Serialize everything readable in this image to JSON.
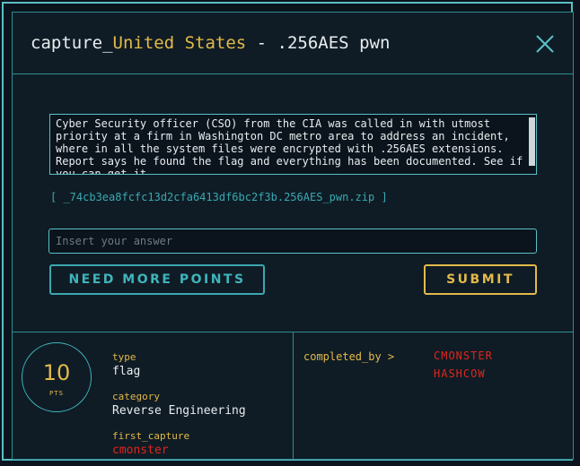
{
  "dialog": {
    "title_prefix": "capture_",
    "title_country": "United States",
    "title_suffix": " - .256AES pwn",
    "close_icon": "close-icon"
  },
  "challenge": {
    "description": "Cyber Security officer (CSO) from the CIA was called in with utmost priority at a firm in Washington DC metro area to address an incident, where in all the system files were encrypted with .256AES extensions. Report says he found the flag and everything has been documented. See if you can get it.",
    "file_link": "[ _74cb3ea8fcfc13d2cfa6413df6bc2f3b.256AES_pwn.zip ]"
  },
  "answer": {
    "placeholder": "Insert your answer",
    "value": ""
  },
  "buttons": {
    "need_points": "NEED MORE POINTS",
    "submit": "SUBMIT"
  },
  "stats": {
    "points_value": "10",
    "points_unit": "PTS",
    "type_label": "type",
    "type_value": "flag",
    "category_label": "category",
    "category_value": "Reverse Engineering",
    "first_capture_label": "first_capture",
    "first_capture_value": "cmonster",
    "completed_by_label": "completed_by >",
    "completed_by": [
      "CMONSTER",
      "HASHCOW"
    ]
  },
  "colors": {
    "accent_teal": "#5bc0c7",
    "accent_yellow": "#e3b94a",
    "accent_red": "#e0261d",
    "background": "#0f1c25"
  }
}
